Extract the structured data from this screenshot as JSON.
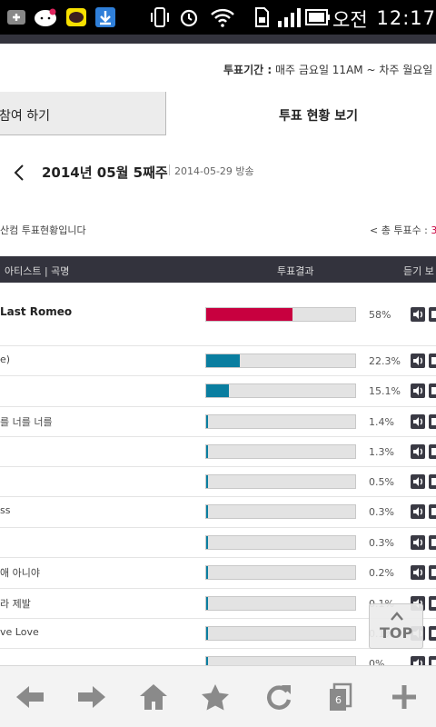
{
  "status_bar": {
    "ampm": "오전",
    "time": "12:17",
    "icons": [
      "add-icon",
      "hello-kitty-icon",
      "kakaotalk-icon",
      "download-icon",
      "vibrate-icon",
      "alarm-icon",
      "wifi-icon",
      "sd-card-icon",
      "signal-icon",
      "battery-icon"
    ]
  },
  "header": {
    "period_label": "투표기간 :",
    "period_value": "매주 금요일 11AM ~ 차주 월요일"
  },
  "tabs": [
    {
      "label": "참여 하기",
      "active": false
    },
    {
      "label": "투표 현황 보기",
      "active": true
    }
  ],
  "week": {
    "title": "2014년 05월 5째주",
    "broadcast_date": "2014-05-29 방송"
  },
  "summary": {
    "intro": "산컴 투표현황입니다",
    "total_label": "< 총 투표수 :",
    "total_value": "3"
  },
  "table": {
    "headers": [
      "아티스트 | 곡명",
      "투표결과",
      "듣기 보"
    ],
    "rows": [
      {
        "title": "Last Romeo",
        "percent_label": "58%",
        "value": 58,
        "color": "#c8003f"
      },
      {
        "title": "e)",
        "percent_label": "22.3%",
        "value": 22.3,
        "color": "#0a7ea0"
      },
      {
        "title": "",
        "percent_label": "15.1%",
        "value": 15.1,
        "color": "#0a7ea0"
      },
      {
        "title": "를 너를 너를",
        "percent_label": "1.4%",
        "value": 1.4,
        "color": "#0a7ea0"
      },
      {
        "title": "",
        "percent_label": "1.3%",
        "value": 1.3,
        "color": "#0a7ea0"
      },
      {
        "title": "",
        "percent_label": "0.5%",
        "value": 0.5,
        "color": "#0a7ea0"
      },
      {
        "title": "ss",
        "percent_label": "0.3%",
        "value": 0.3,
        "color": "#0a7ea0"
      },
      {
        "title": "",
        "percent_label": "0.3%",
        "value": 0.3,
        "color": "#0a7ea0"
      },
      {
        "title": "애 아니야",
        "percent_label": "0.2%",
        "value": 0.2,
        "color": "#0a7ea0"
      },
      {
        "title": "라 제발",
        "percent_label": "0.1%",
        "value": 0.1,
        "color": "#0a7ea0"
      },
      {
        "title": "ve Love",
        "percent_label": "0.1%",
        "value": 0.1,
        "color": "#0a7ea0"
      },
      {
        "title": "",
        "percent_label": "0%",
        "value": 0,
        "color": "#0a7ea0"
      }
    ]
  },
  "top_button": {
    "label": "TOP"
  },
  "browser_bar": {
    "icons": [
      "back-arrow-icon",
      "forward-arrow-icon",
      "home-icon",
      "bookmark-star-icon",
      "refresh-icon",
      "windows-icon",
      "add-tab-icon"
    ],
    "window_count": "6"
  }
}
